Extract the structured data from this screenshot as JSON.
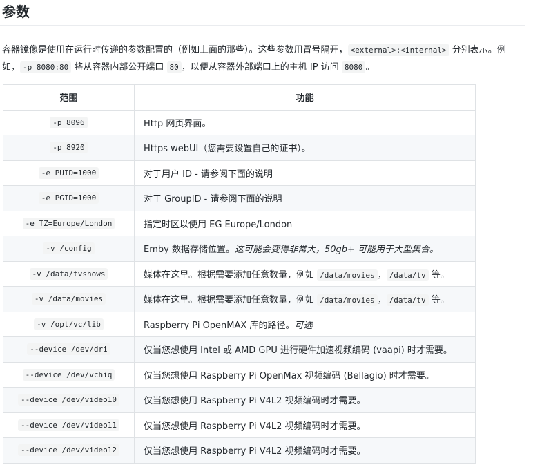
{
  "title": "参数",
  "intro": {
    "t1": "容器镜像是使用在运行时传递的参数配置的（例如上面的那些）。这些参数用冒号隔开，",
    "c1": "<external>:<internal>",
    "t2": " 分别表示。例如，",
    "c2": "-p 8080:80",
    "t3": " 将从容器内部公开端口 ",
    "c3": "80",
    "t4": "，以便从容器外部端口上的主机 IP 访问 ",
    "c4": "8080",
    "t5": "。"
  },
  "table": {
    "headers": {
      "param": "范围",
      "function": "功能"
    },
    "rows": [
      {
        "param": "-p 8096",
        "func": {
          "t1": "Http 网页界面。"
        }
      },
      {
        "param": "-p 8920",
        "func": {
          "t1": "Https webUI（您需要设置自己的证书）。"
        }
      },
      {
        "param": "-e PUID=1000",
        "func": {
          "t1": "对于用户 ID - 请参阅下面的说明"
        }
      },
      {
        "param": "-e PGID=1000",
        "func": {
          "t1": "对于 GroupID - 请参阅下面的说明"
        }
      },
      {
        "param": "-e TZ=Europe/London",
        "func": {
          "t1": "指定时区以使用 EG Europe/London"
        }
      },
      {
        "param": "-v /config",
        "func": {
          "t1": "Emby 数据存储位置。",
          "em": "这可能会变得非常大，50gb+ 可能用于大型集合。"
        }
      },
      {
        "param": "-v /data/tvshows",
        "func": {
          "t1": "媒体在这里。根据需要添加任意数量，例如 ",
          "c1": "/data/movies",
          "t2": "，",
          "c2": "/data/tv",
          "t3": " 等。"
        }
      },
      {
        "param": "-v /data/movies",
        "func": {
          "t1": "媒体在这里。根据需要添加任意数量，例如 ",
          "c1": "/data/movies",
          "t2": "，",
          "c2": "/data/tv",
          "t3": " 等。"
        }
      },
      {
        "param": "-v /opt/vc/lib",
        "func": {
          "t1": "Raspberry Pi OpenMAX 库的路径",
          "em": "可选",
          "t2": "。"
        }
      },
      {
        "param": "--device /dev/dri",
        "func": {
          "t1": "仅当您想使用 Intel 或 AMD GPU 进行硬件加速视频编码 (vaapi) 时才需要。"
        }
      },
      {
        "param": "--device /dev/vchiq",
        "func": {
          "t1": "仅当您想使用 Raspberry Pi OpenMax 视频编码 (Bellagio) 时才需要。"
        }
      },
      {
        "param": "--device /dev/video10",
        "func": {
          "t1": "仅当您想使用 Raspberry Pi V4L2 视频编码时才需要。"
        }
      },
      {
        "param": "--device /dev/video11",
        "func": {
          "t1": "仅当您想使用 Raspberry Pi V4L2 视频编码时才需要。"
        }
      },
      {
        "param": "--device /dev/video12",
        "func": {
          "t1": "仅当您想使用 Raspberry Pi V4L2 视频编码时才需要。"
        }
      }
    ]
  }
}
